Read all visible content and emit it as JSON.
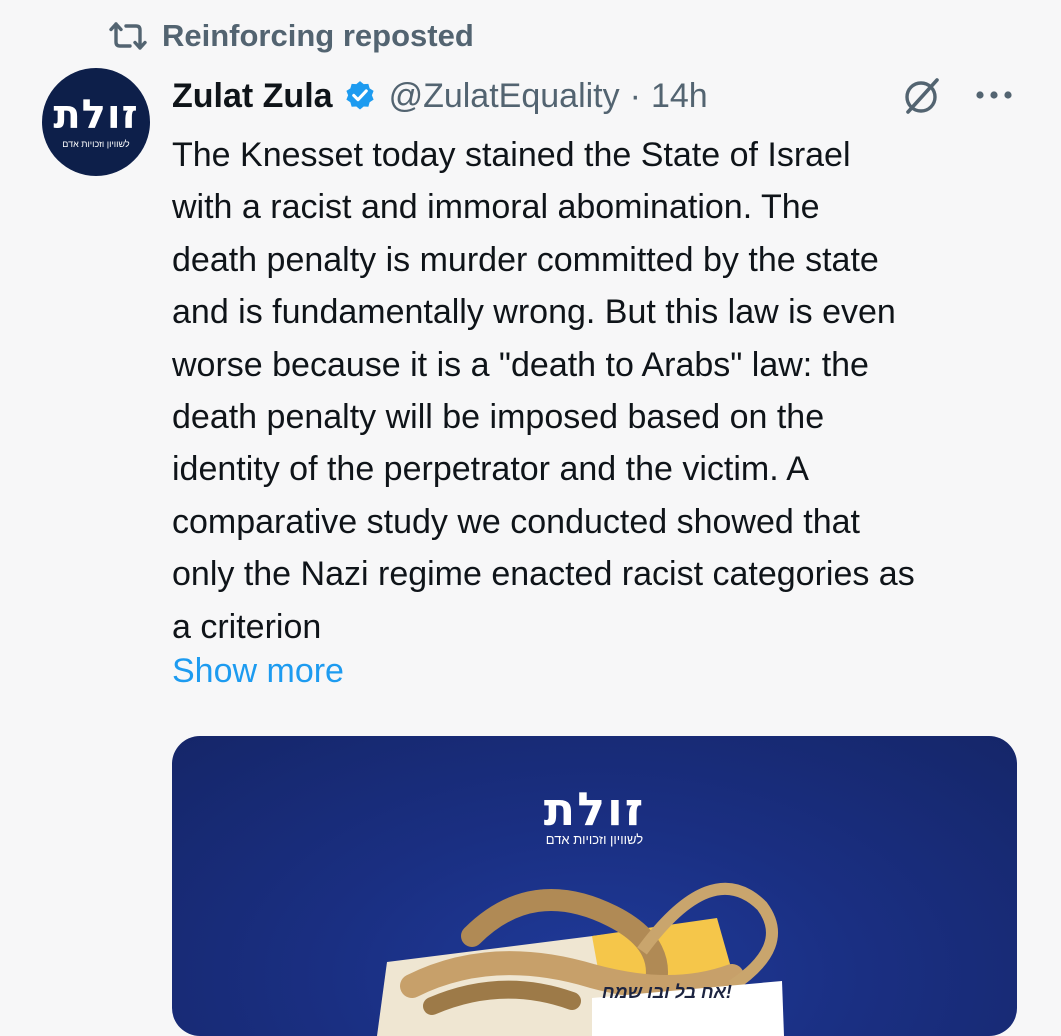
{
  "repost": {
    "label": "Reinforcing reposted",
    "icon": "repost-icon"
  },
  "post": {
    "author": {
      "name": "Zulat Zula",
      "handle": "@ZulatEquality",
      "verified_icon": "verified-badge-icon",
      "avatar_logo": "זולת",
      "avatar_tagline": "לשוויון וזכויות אדם"
    },
    "separator": "·",
    "timestamp": "14h",
    "actions": {
      "grok_icon": "grok-icon",
      "more_icon": "more-options-icon"
    },
    "text_lines": [
      "The Knesset today stained the State of Israel",
      "with a racist and immoral abomination. The",
      "death penalty is murder committed by the state",
      "and is fundamentally wrong. But this law is even",
      "worse because it is a \"death to Arabs\" law: the",
      "death penalty will be imposed based on the",
      "identity of the perpetrator and the victim. A",
      "comparative study we conducted showed that",
      "only the Nazi regime enacted racist categories as",
      "a criterion"
    ],
    "show_more": "Show more",
    "media": {
      "logo": "זולת",
      "tagline": "לשוויון וזכויות אדם",
      "note": "אח בל ובו שמח!"
    }
  },
  "colors": {
    "background": "#f7f7f8",
    "link": "#1d9bf0",
    "muted": "#536471",
    "verified": "#1d9bf0",
    "media_bg": "#1a2f82"
  }
}
